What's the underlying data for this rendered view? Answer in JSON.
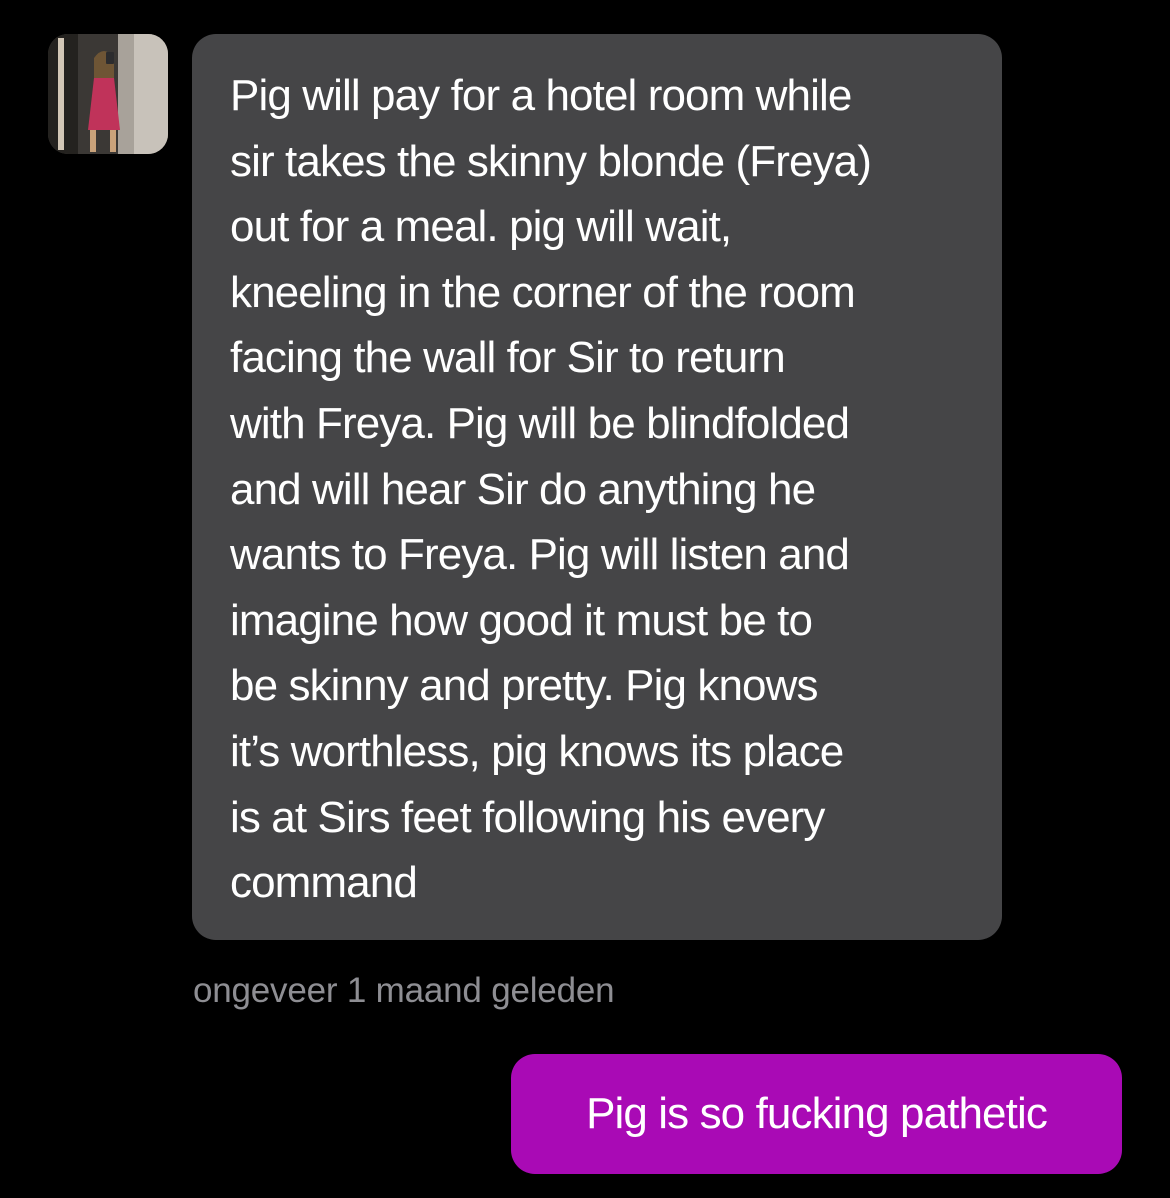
{
  "conversation": {
    "incoming": {
      "avatar_icon": "profile-photo",
      "text": "Pig will pay for a hotel room while\nsir takes the skinny blonde (Freya)\nout for a meal. pig will wait,\nkneeling in the corner of the room\nfacing the wall for Sir to return\nwith Freya. Pig will be blindfolded\nand will hear Sir do anything he\nwants to Freya. Pig will listen and\nimagine how good it must be to\nbe skinny and pretty. Pig knows\nit’s worthless, pig knows its place\nis at Sirs feet following his every\ncommand",
      "timestamp": "ongeveer 1 maand geleden"
    },
    "outgoing": {
      "text": "Pig is so fucking pathetic"
    }
  },
  "colors": {
    "background": "#000000",
    "incoming_bubble": "#454547",
    "outgoing_bubble": "#a90ab5",
    "timestamp": "#8e8e93",
    "message_text": "#ffffff"
  }
}
